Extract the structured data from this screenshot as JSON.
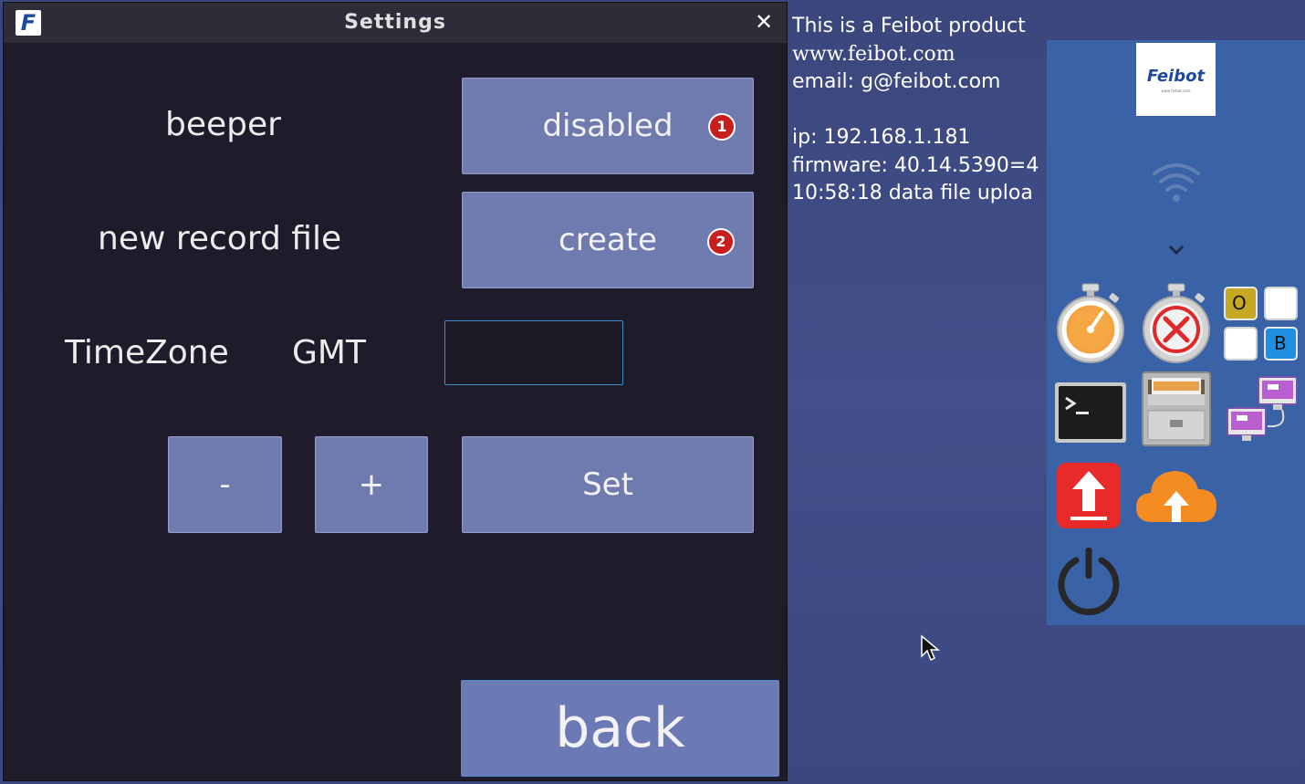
{
  "window": {
    "title": "Settings",
    "close_glyph": "✕",
    "logo_letter": "F"
  },
  "settings": {
    "beeper_label": "beeper",
    "beeper_button": "disabled",
    "beeper_badge": "1",
    "record_label": "new record file",
    "record_button": "create",
    "record_badge": "2",
    "timezone_label": "TimeZone",
    "gmt_label": "GMT",
    "timezone_value": "",
    "minus_button": "-",
    "plus_button": "+",
    "set_button": "Set",
    "back_button": "back"
  },
  "desktop_info": {
    "line1": "This is a Feibot product",
    "line2": "www.feibot.com",
    "line3": "email: g@feibot.com",
    "line4": "",
    "line5": "ip: 192.168.1.181",
    "line6": "firmware: 40.14.5390=4",
    "line7": "10:58:18 data file uploa"
  },
  "panel": {
    "logo_brand": "Feibot",
    "logo_url": "www.feibot.com",
    "tile_o": "O",
    "tile_b": "B",
    "icons": [
      "wifi-icon",
      "chevron-down-icon",
      "stopwatch-icon",
      "stopwatch-cancel-icon",
      "ob-tiles-icon",
      "terminal-icon",
      "file-cabinet-icon",
      "network-monitors-icon",
      "upload-icon",
      "cloud-upload-icon",
      "power-icon"
    ]
  },
  "colors": {
    "window_bg": "#1e1c2a",
    "button": "#6f7aae",
    "desktop": "#3f4a82",
    "panel": "#3a62a6",
    "badge": "#c81e1e"
  }
}
